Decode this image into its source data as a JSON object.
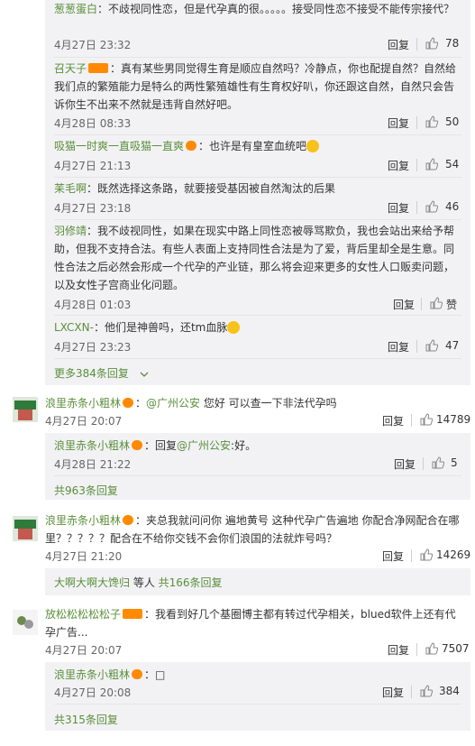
{
  "thread1": {
    "replies": [
      {
        "user": "葱葱蛋白",
        "text": "：不歧视同性恋，但是代孕真的很。。。。。接受同性恋不接受不能传宗接代？",
        "time": "4月27日 23:32",
        "reply": "回复",
        "likes": "78"
      },
      {
        "user": "召天子",
        "text": "：真有某些男同觉得生育是顺应自然吗？冷静点，你也配提自然？自然给我们点的繁殖能力是特么的两性繁殖雄性有生育权好叭，你还跟这自然，自然只会告诉你生不出来不然就是违背自然好吧。",
        "time": "4月28日 08:33",
        "reply": "回复",
        "likes": "50"
      },
      {
        "user": "吸猫一时爽一直吸猫一直爽",
        "text": "：也许是有皇室血统吧",
        "time": "4月27日 21:13",
        "reply": "回复",
        "likes": "54"
      },
      {
        "user": "苿毛啊",
        "text": "：既然选择这条路，就要接受基因被自然淘汰的后果",
        "time": "4月27日 23:18",
        "reply": "回复",
        "likes": "46"
      },
      {
        "user": "羽修靖",
        "text": "：我不歧视同性，如果在现实中路上同性恋被辱骂欺负，我也会站出来给予帮助，但我不支持合法。有些人表面上支持同性合法是为了爱，背后里却全是生意。同性合法之后必然会形成一个代孕的产业链，那么将会迎来更多的女性人口贩卖问题，以及女性子宫商业化问题。",
        "time": "4月28日 01:03",
        "reply": "回复",
        "likes": "赞"
      },
      {
        "user": "LXCXN-",
        "text": "：他们是神兽吗，还tm血脉",
        "time": "4月27日 23:23",
        "reply": "回复",
        "likes": "47"
      }
    ],
    "more": "更多384条回复"
  },
  "comments": [
    {
      "user": "浪里赤条小粗林",
      "mention": "@广州公安",
      "text": " 您好 可以查一下非法代孕吗",
      "time": "4月27日 20:07",
      "reply": "回复",
      "likes": "14789",
      "sub": {
        "user": "浪里赤条小粗林",
        "text": "：回复",
        "mention": "@广州公安",
        "tail": ":好。",
        "time": "4月28日 21:22",
        "reply": "回复",
        "likes": "5"
      },
      "total": "共963条回复"
    },
    {
      "user": "浪里赤条小粗林",
      "text": "：夹总我就问问你 遍地黄号 这种代孕广告遍地 你配合净网配合在哪里？？？？？配合在不给你交钱不会你们浪国的法就炸号吗？",
      "time": "4月27日 21:20",
      "reply": "回复",
      "likes": "14269",
      "total_user": "大啊大啊大馋归",
      "total_mid": " 等人 ",
      "total": "共166条回复"
    },
    {
      "user": "放松松松松松子",
      "text": "：我看到好几个基圈博主都有转过代孕相关，blued软件上还有代孕广告...",
      "time": "4月27日 20:07",
      "reply": "回复",
      "likes": "7507",
      "sub": {
        "user": "浪里赤条小粗林",
        "text": "：□",
        "time": "4月27日 20:08",
        "reply": "回复",
        "likes": "384"
      },
      "total": "共315条回复"
    }
  ],
  "icons": {
    "thumb": "thumb-up-icon",
    "chevron": "chevron-down-icon",
    "vip": "vip-badge-icon"
  },
  "colors": {
    "username": "#5a8f3a",
    "reply_bg": "#f2f2f5",
    "vip": "#ff8a00"
  }
}
